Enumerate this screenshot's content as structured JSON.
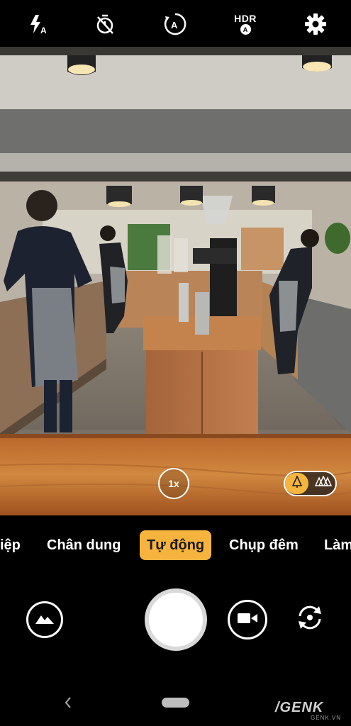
{
  "top_bar": {
    "flash_mode": "A",
    "hdr_label": "HDR",
    "hdr_mode": "A",
    "timer_mode": "A"
  },
  "viewfinder": {
    "zoom_label": "1x"
  },
  "modes": [
    {
      "label": "iệp"
    },
    {
      "label": "Chân dung"
    },
    {
      "label": "Tự động",
      "selected": true
    },
    {
      "label": "Chụp đêm"
    },
    {
      "label": "Làm"
    }
  ],
  "watermark": {
    "brand": "/GENK",
    "domain": "GENK.VN"
  },
  "colors": {
    "accent": "#f6b43e",
    "background": "#000000"
  }
}
